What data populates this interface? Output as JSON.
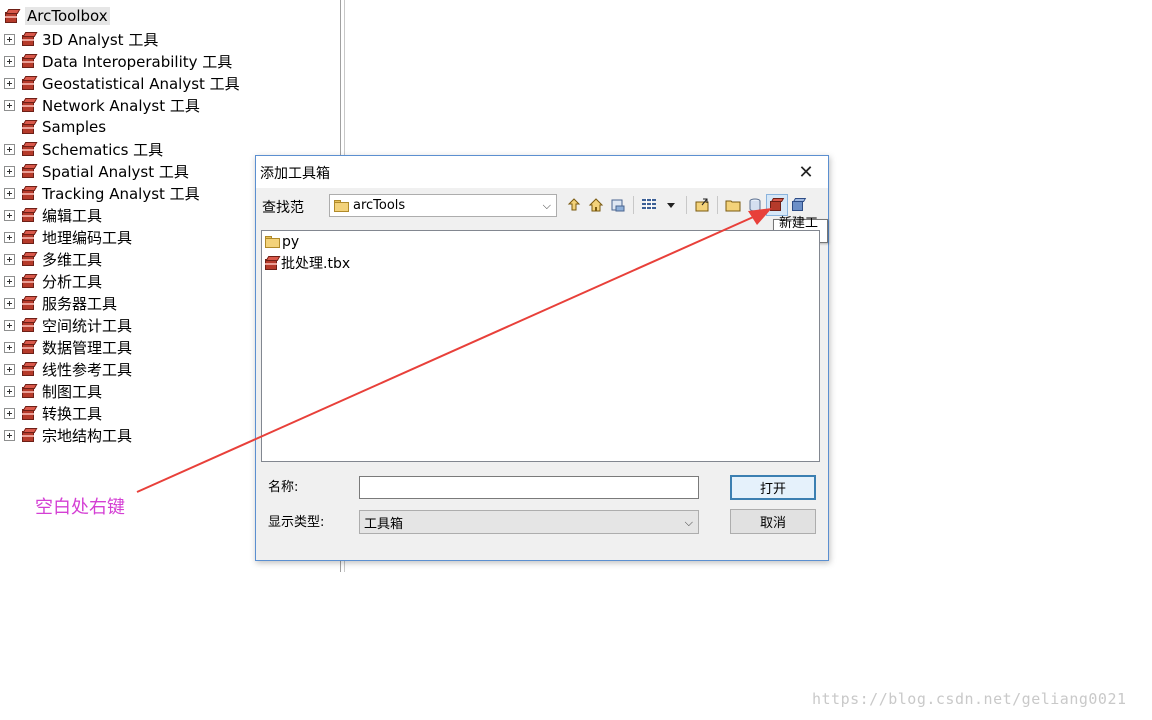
{
  "toolbox": {
    "root_label": "ArcToolbox",
    "items": [
      {
        "label": "3D Analyst 工具",
        "expandable": true
      },
      {
        "label": "Data Interoperability 工具",
        "expandable": true
      },
      {
        "label": "Geostatistical Analyst 工具",
        "expandable": true
      },
      {
        "label": "Network Analyst 工具",
        "expandable": true
      },
      {
        "label": "Samples",
        "expandable": false
      },
      {
        "label": "Schematics 工具",
        "expandable": true
      },
      {
        "label": "Spatial Analyst 工具",
        "expandable": true
      },
      {
        "label": "Tracking Analyst 工具",
        "expandable": true
      },
      {
        "label": "编辑工具",
        "expandable": true
      },
      {
        "label": "地理编码工具",
        "expandable": true
      },
      {
        "label": "多维工具",
        "expandable": true
      },
      {
        "label": "分析工具",
        "expandable": true
      },
      {
        "label": "服务器工具",
        "expandable": true
      },
      {
        "label": "空间统计工具",
        "expandable": true
      },
      {
        "label": "数据管理工具",
        "expandable": true
      },
      {
        "label": "线性参考工具",
        "expandable": true
      },
      {
        "label": "制图工具",
        "expandable": true
      },
      {
        "label": "转换工具",
        "expandable": true
      },
      {
        "label": "宗地结构工具",
        "expandable": true
      }
    ]
  },
  "dialog": {
    "title": "添加工具箱",
    "close_glyph": "✕",
    "look_in_label": "查找范",
    "look_in_value": "arcTools",
    "toolbar_icons": [
      "up-folder-icon",
      "home-icon",
      "connect-folder-icon",
      "view-list-icon",
      "view-dropdown-icon",
      "connect-icon",
      "new-folder-icon",
      "new-database-icon",
      "new-toolbox-icon",
      "new-toolbox-alt-icon"
    ],
    "tooltip": "新建工具箱",
    "files": [
      {
        "name": "py",
        "type": "folder"
      },
      {
        "name": "批处理.tbx",
        "type": "toolbox"
      }
    ],
    "name_label": "名称:",
    "name_value": "",
    "type_label": "显示类型:",
    "type_value": "工具箱",
    "open_button": "打开",
    "cancel_button": "取消"
  },
  "annotation": {
    "text": "空白处右键",
    "color": "#d43fd4",
    "arrow_color": "#e8403a"
  },
  "watermark": "https://blog.csdn.net/geliang0021",
  "colors": {
    "dialog_border": "#5b8fd0",
    "toolbox_red": "#b53a2a"
  }
}
